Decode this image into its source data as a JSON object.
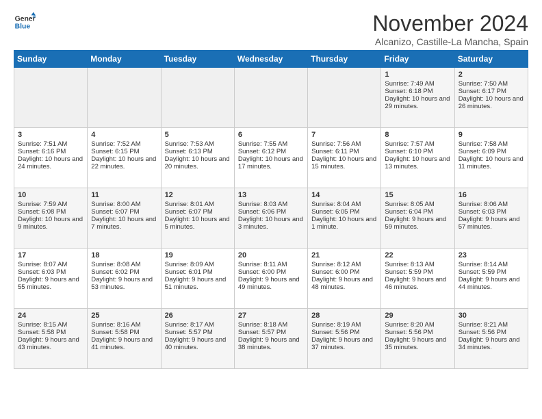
{
  "logo": {
    "line1": "General",
    "line2": "Blue"
  },
  "title": "November 2024",
  "location": "Alcanizo, Castille-La Mancha, Spain",
  "days_of_week": [
    "Sunday",
    "Monday",
    "Tuesday",
    "Wednesday",
    "Thursday",
    "Friday",
    "Saturday"
  ],
  "weeks": [
    [
      {
        "day": "",
        "empty": true
      },
      {
        "day": "",
        "empty": true
      },
      {
        "day": "",
        "empty": true
      },
      {
        "day": "",
        "empty": true
      },
      {
        "day": "",
        "empty": true
      },
      {
        "day": "1",
        "sunrise": "Sunrise: 7:49 AM",
        "sunset": "Sunset: 6:18 PM",
        "daylight": "Daylight: 10 hours and 29 minutes."
      },
      {
        "day": "2",
        "sunrise": "Sunrise: 7:50 AM",
        "sunset": "Sunset: 6:17 PM",
        "daylight": "Daylight: 10 hours and 26 minutes."
      }
    ],
    [
      {
        "day": "3",
        "sunrise": "Sunrise: 7:51 AM",
        "sunset": "Sunset: 6:16 PM",
        "daylight": "Daylight: 10 hours and 24 minutes."
      },
      {
        "day": "4",
        "sunrise": "Sunrise: 7:52 AM",
        "sunset": "Sunset: 6:15 PM",
        "daylight": "Daylight: 10 hours and 22 minutes."
      },
      {
        "day": "5",
        "sunrise": "Sunrise: 7:53 AM",
        "sunset": "Sunset: 6:13 PM",
        "daylight": "Daylight: 10 hours and 20 minutes."
      },
      {
        "day": "6",
        "sunrise": "Sunrise: 7:55 AM",
        "sunset": "Sunset: 6:12 PM",
        "daylight": "Daylight: 10 hours and 17 minutes."
      },
      {
        "day": "7",
        "sunrise": "Sunrise: 7:56 AM",
        "sunset": "Sunset: 6:11 PM",
        "daylight": "Daylight: 10 hours and 15 minutes."
      },
      {
        "day": "8",
        "sunrise": "Sunrise: 7:57 AM",
        "sunset": "Sunset: 6:10 PM",
        "daylight": "Daylight: 10 hours and 13 minutes."
      },
      {
        "day": "9",
        "sunrise": "Sunrise: 7:58 AM",
        "sunset": "Sunset: 6:09 PM",
        "daylight": "Daylight: 10 hours and 11 minutes."
      }
    ],
    [
      {
        "day": "10",
        "sunrise": "Sunrise: 7:59 AM",
        "sunset": "Sunset: 6:08 PM",
        "daylight": "Daylight: 10 hours and 9 minutes."
      },
      {
        "day": "11",
        "sunrise": "Sunrise: 8:00 AM",
        "sunset": "Sunset: 6:07 PM",
        "daylight": "Daylight: 10 hours and 7 minutes."
      },
      {
        "day": "12",
        "sunrise": "Sunrise: 8:01 AM",
        "sunset": "Sunset: 6:07 PM",
        "daylight": "Daylight: 10 hours and 5 minutes."
      },
      {
        "day": "13",
        "sunrise": "Sunrise: 8:03 AM",
        "sunset": "Sunset: 6:06 PM",
        "daylight": "Daylight: 10 hours and 3 minutes."
      },
      {
        "day": "14",
        "sunrise": "Sunrise: 8:04 AM",
        "sunset": "Sunset: 6:05 PM",
        "daylight": "Daylight: 10 hours and 1 minute."
      },
      {
        "day": "15",
        "sunrise": "Sunrise: 8:05 AM",
        "sunset": "Sunset: 6:04 PM",
        "daylight": "Daylight: 9 hours and 59 minutes."
      },
      {
        "day": "16",
        "sunrise": "Sunrise: 8:06 AM",
        "sunset": "Sunset: 6:03 PM",
        "daylight": "Daylight: 9 hours and 57 minutes."
      }
    ],
    [
      {
        "day": "17",
        "sunrise": "Sunrise: 8:07 AM",
        "sunset": "Sunset: 6:03 PM",
        "daylight": "Daylight: 9 hours and 55 minutes."
      },
      {
        "day": "18",
        "sunrise": "Sunrise: 8:08 AM",
        "sunset": "Sunset: 6:02 PM",
        "daylight": "Daylight: 9 hours and 53 minutes."
      },
      {
        "day": "19",
        "sunrise": "Sunrise: 8:09 AM",
        "sunset": "Sunset: 6:01 PM",
        "daylight": "Daylight: 9 hours and 51 minutes."
      },
      {
        "day": "20",
        "sunrise": "Sunrise: 8:11 AM",
        "sunset": "Sunset: 6:00 PM",
        "daylight": "Daylight: 9 hours and 49 minutes."
      },
      {
        "day": "21",
        "sunrise": "Sunrise: 8:12 AM",
        "sunset": "Sunset: 6:00 PM",
        "daylight": "Daylight: 9 hours and 48 minutes."
      },
      {
        "day": "22",
        "sunrise": "Sunrise: 8:13 AM",
        "sunset": "Sunset: 5:59 PM",
        "daylight": "Daylight: 9 hours and 46 minutes."
      },
      {
        "day": "23",
        "sunrise": "Sunrise: 8:14 AM",
        "sunset": "Sunset: 5:59 PM",
        "daylight": "Daylight: 9 hours and 44 minutes."
      }
    ],
    [
      {
        "day": "24",
        "sunrise": "Sunrise: 8:15 AM",
        "sunset": "Sunset: 5:58 PM",
        "daylight": "Daylight: 9 hours and 43 minutes."
      },
      {
        "day": "25",
        "sunrise": "Sunrise: 8:16 AM",
        "sunset": "Sunset: 5:58 PM",
        "daylight": "Daylight: 9 hours and 41 minutes."
      },
      {
        "day": "26",
        "sunrise": "Sunrise: 8:17 AM",
        "sunset": "Sunset: 5:57 PM",
        "daylight": "Daylight: 9 hours and 40 minutes."
      },
      {
        "day": "27",
        "sunrise": "Sunrise: 8:18 AM",
        "sunset": "Sunset: 5:57 PM",
        "daylight": "Daylight: 9 hours and 38 minutes."
      },
      {
        "day": "28",
        "sunrise": "Sunrise: 8:19 AM",
        "sunset": "Sunset: 5:56 PM",
        "daylight": "Daylight: 9 hours and 37 minutes."
      },
      {
        "day": "29",
        "sunrise": "Sunrise: 8:20 AM",
        "sunset": "Sunset: 5:56 PM",
        "daylight": "Daylight: 9 hours and 35 minutes."
      },
      {
        "day": "30",
        "sunrise": "Sunrise: 8:21 AM",
        "sunset": "Sunset: 5:56 PM",
        "daylight": "Daylight: 9 hours and 34 minutes."
      }
    ]
  ]
}
